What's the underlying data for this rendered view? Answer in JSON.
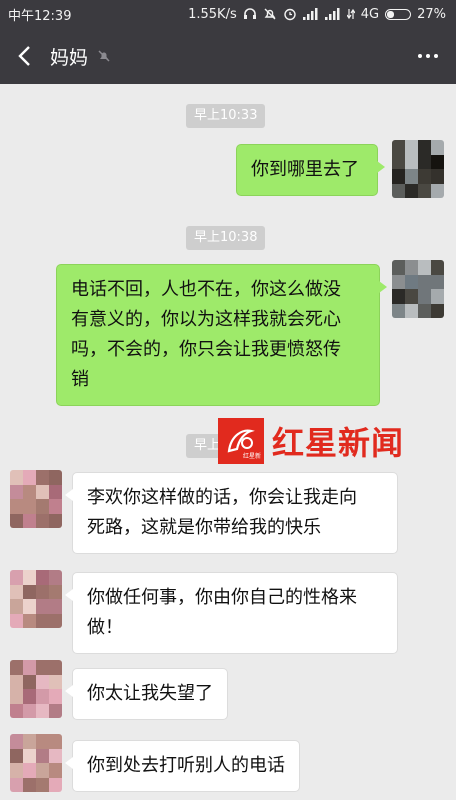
{
  "status_bar": {
    "time": "中午12:39",
    "speed": "1.55K/s",
    "network": "4G",
    "battery": "27%"
  },
  "header": {
    "title": "妈妈",
    "back_icon": "back-arrow-icon",
    "mute_icon": "mute-bell-icon",
    "more_icon": "more-dots-icon"
  },
  "messages": [
    {
      "type": "timestamp",
      "text": "早上10:33"
    },
    {
      "type": "out",
      "text": "你到哪里去了"
    },
    {
      "type": "timestamp",
      "text": "早上10:38"
    },
    {
      "type": "out",
      "lines": [
        "电话不回，人也不在，你这么做没",
        "有意义的，你以为这样我就会死心",
        "吗，不会的，你只会让我更愤怒传",
        "销"
      ]
    },
    {
      "type": "timestamp",
      "text": "早上"
    },
    {
      "type": "in",
      "lines": [
        "李欢你这样做的话，你会让我走向",
        "死路，这就是你带给我的快乐"
      ]
    },
    {
      "type": "in",
      "lines": [
        "你做任何事，你由你自己的性格来",
        "做！"
      ]
    },
    {
      "type": "in",
      "text": "你太让我失望了"
    },
    {
      "type": "in",
      "text": "你到处去打听别人的电话"
    }
  ],
  "watermark": {
    "text": "红星新闻",
    "logo_text": "红星新闻"
  },
  "colors": {
    "header_bg": "#3b3a3f",
    "chat_bg": "#ebebeb",
    "out_bubble": "#9eea6a",
    "in_bubble": "#ffffff",
    "brand_red": "#e12a1e"
  }
}
